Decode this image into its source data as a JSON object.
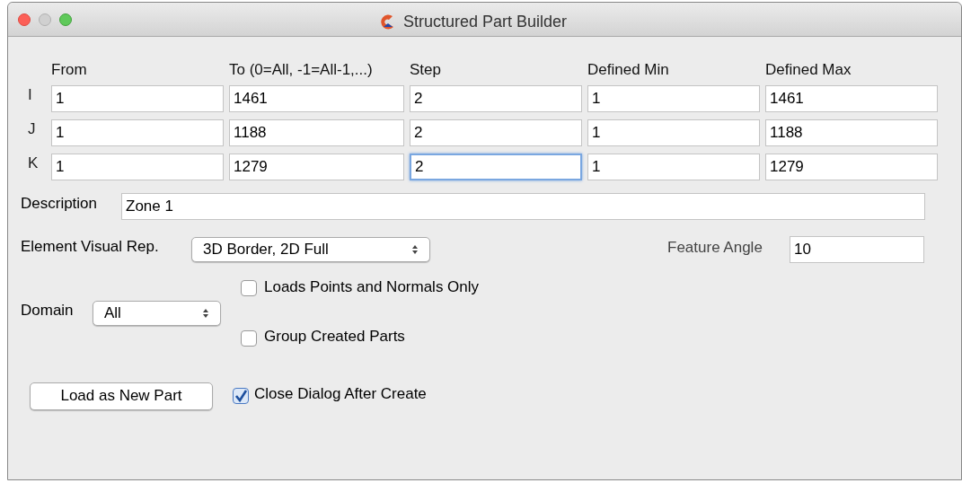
{
  "window": {
    "title": "Structured Part Builder"
  },
  "columns": [
    "From",
    "To  (0=All,  -1=All-1,...)",
    "Step",
    "Defined Min",
    "Defined Max"
  ],
  "rows": [
    {
      "label": "I",
      "cells": [
        {
          "value": "1",
          "focused": false
        },
        {
          "value": "1461",
          "focused": false
        },
        {
          "value": "2",
          "focused": false
        },
        {
          "value": "1",
          "focused": false
        },
        {
          "value": "1461",
          "focused": false
        }
      ]
    },
    {
      "label": "J",
      "cells": [
        {
          "value": "1",
          "focused": false
        },
        {
          "value": "1188",
          "focused": false
        },
        {
          "value": "2",
          "focused": false
        },
        {
          "value": "1",
          "focused": false
        },
        {
          "value": "1188",
          "focused": false
        }
      ]
    },
    {
      "label": "K",
      "cells": [
        {
          "value": "1",
          "focused": false
        },
        {
          "value": "1279",
          "focused": false
        },
        {
          "value": "2",
          "focused": true
        },
        {
          "value": "1",
          "focused": false
        },
        {
          "value": "1279",
          "focused": false
        }
      ]
    }
  ],
  "description": {
    "label": "Description",
    "value": "Zone 1"
  },
  "element_visual_rep": {
    "label": "Element Visual Rep.",
    "value": "3D Border, 2D Full"
  },
  "feature_angle": {
    "label": "Feature Angle",
    "value": "10"
  },
  "domain": {
    "label": "Domain",
    "value": "All"
  },
  "options": [
    {
      "label": "Loads Points and Normals Only",
      "checked": false
    },
    {
      "label": "Group Created Parts",
      "checked": false
    }
  ],
  "load_button": "Load as New Part",
  "close_after_create": {
    "label": "Close Dialog After Create",
    "checked": true
  }
}
